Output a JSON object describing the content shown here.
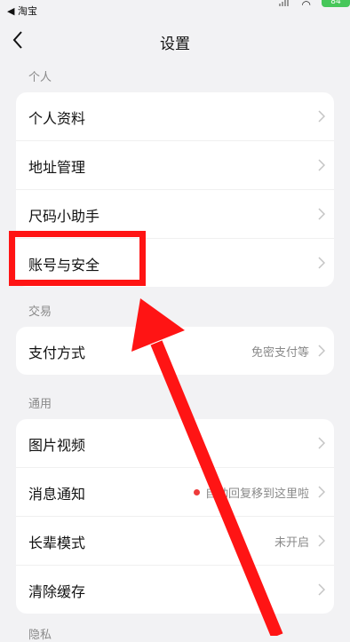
{
  "status_bar": {
    "back_app": "◀ 淘宝",
    "battery": "84"
  },
  "nav": {
    "title": "设置"
  },
  "sections": [
    {
      "label": "个人",
      "items": [
        {
          "label": "个人资料",
          "value": ""
        },
        {
          "label": "地址管理",
          "value": ""
        },
        {
          "label": "尺码小助手",
          "value": ""
        },
        {
          "label": "账号与安全",
          "value": ""
        }
      ]
    },
    {
      "label": "交易",
      "items": [
        {
          "label": "支付方式",
          "value": "免密支付等"
        }
      ]
    },
    {
      "label": "通用",
      "items": [
        {
          "label": "图片视频",
          "value": ""
        },
        {
          "label": "消息通知",
          "value": "自动回复移到这里啦"
        },
        {
          "label": "长辈模式",
          "value": "未开启"
        },
        {
          "label": "清除缓存",
          "value": ""
        }
      ]
    },
    {
      "label": "隐私"
    }
  ],
  "colors": {
    "background": "#f2f2f4",
    "annotation": "#ff1414",
    "dot": "#ee3b3b"
  }
}
